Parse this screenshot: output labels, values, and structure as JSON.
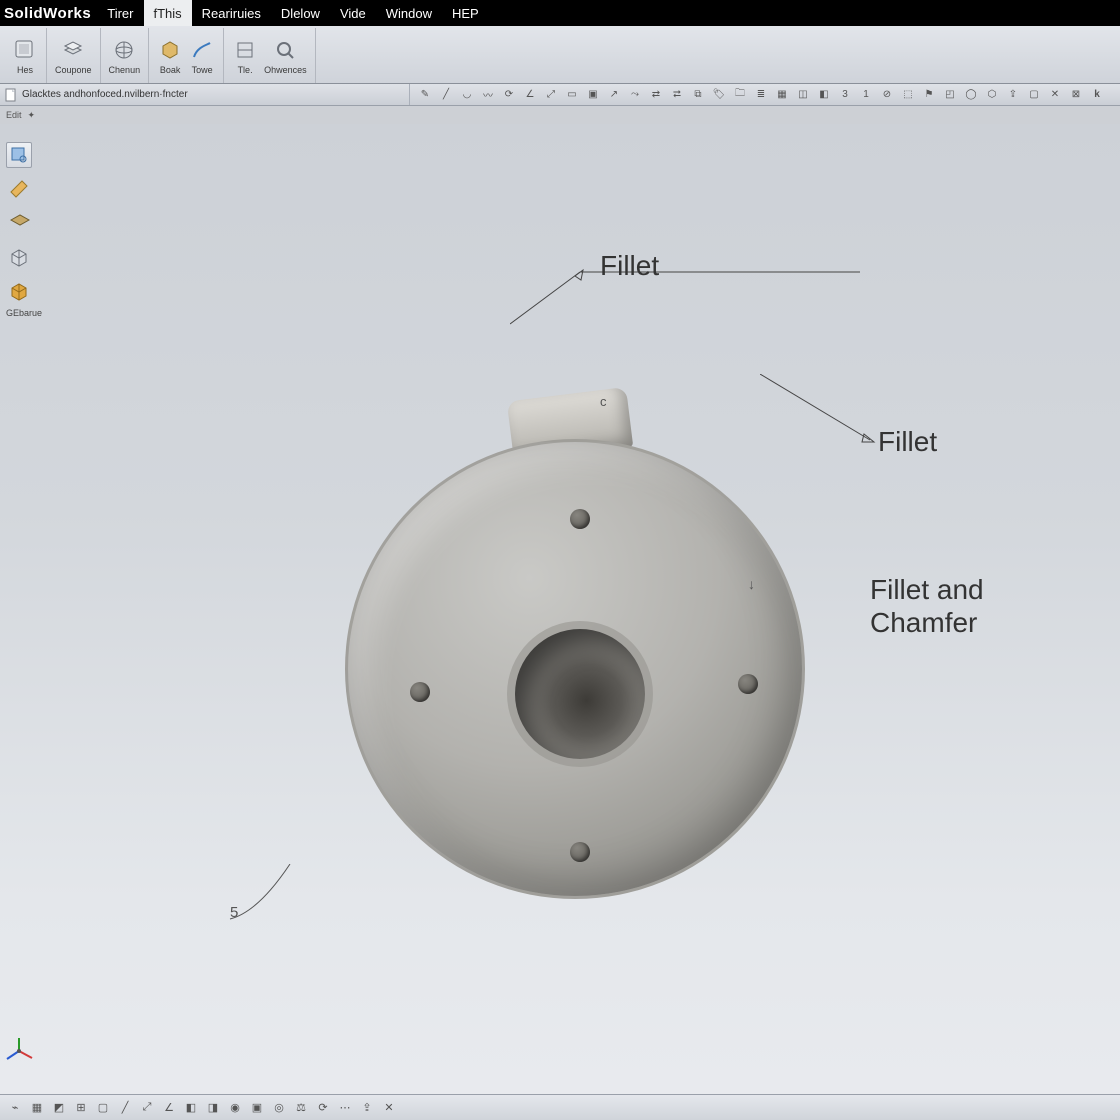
{
  "app_title": "SolidWorks",
  "menus": [
    "Tirer",
    "fThis",
    "Reariruies",
    "Dlelow",
    "Vide",
    "Window",
    "HEP"
  ],
  "active_menu_index": 1,
  "ribbon": {
    "groups": [
      "Hes",
      "Coupone",
      "Chenun",
      "Boak",
      "Towe",
      "Tle.",
      "Ohwences"
    ]
  },
  "document_path": "Glacktes andhonfoced.nvilbern·fncter",
  "subheader": {
    "label": "Edit",
    "glyph": "✦"
  },
  "left_tools_last_label": "GEbarue",
  "annotations": {
    "fillet_top": "Fillet",
    "fillet_right": "Fillet",
    "fillet_chamfer_line1": "Fillet and",
    "fillet_chamfer_line2": "Chamfer",
    "tick_c": "c",
    "tick_arrow": "↓",
    "tick_5": "5"
  }
}
